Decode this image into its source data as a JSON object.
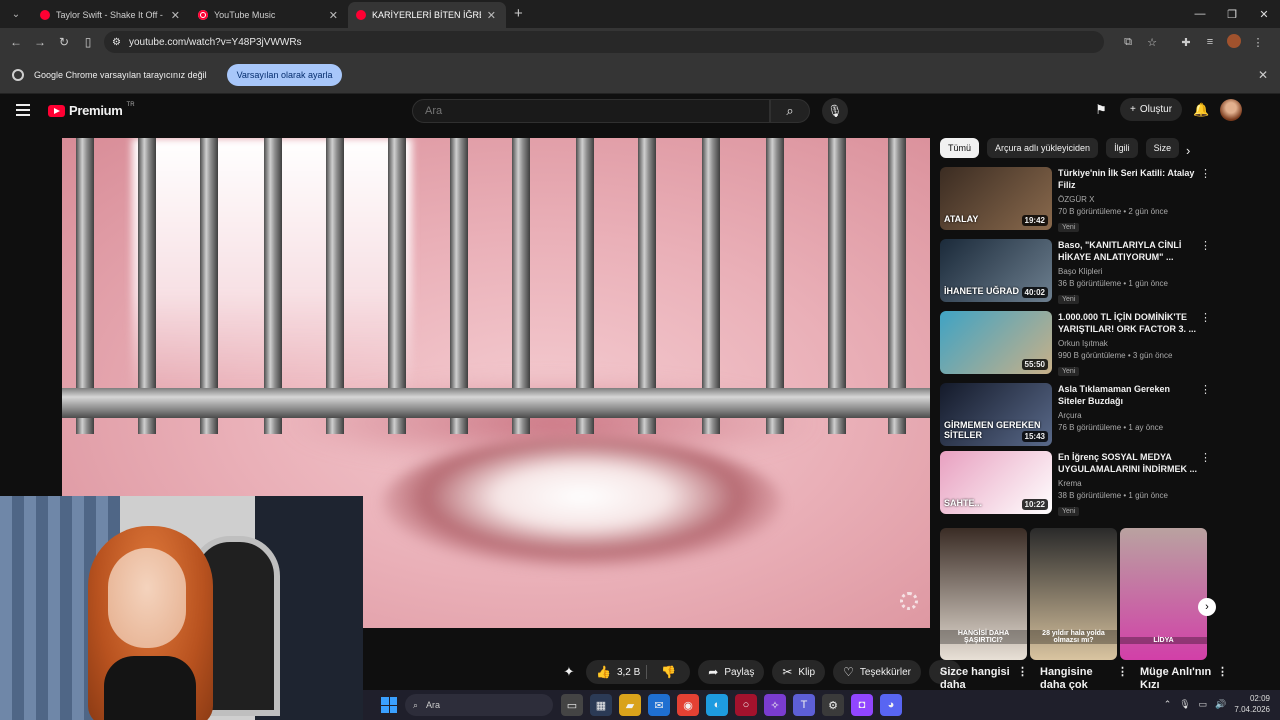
{
  "browser": {
    "tabs": [
      {
        "title": "Taylor Swift - Shake It Off - You",
        "icon": "youtube-icon",
        "active": false
      },
      {
        "title": "YouTube Music",
        "icon": "youtube-music-icon",
        "active": false
      },
      {
        "title": "KARİYERLERİ BİTEN İĞRENÇ YO",
        "icon": "youtube-icon",
        "active": true
      }
    ],
    "url": "youtube.com/watch?v=Y48P3jVWWRs",
    "infobar": {
      "message": "Google Chrome varsayılan tarayıcınız değil",
      "button": "Varsayılan olarak ayarla"
    }
  },
  "youtube": {
    "logo_text": "Premium",
    "logo_tag": "TR",
    "search_placeholder": "Ara",
    "create_label": "Oluştur",
    "actions": {
      "likes": "3,2 B",
      "share": "Paylaş",
      "clip": "Klip",
      "thanks": "Teşekkürler"
    },
    "chips": [
      "Tümü",
      "Arçura adlı yükleyiciden",
      "İlgili",
      "Size"
    ],
    "recommendations": [
      {
        "title": "Türkiye'nin İlk Seri Katili: Atalay Filiz",
        "channel": "ÖZGÜR X",
        "meta": "70 B görüntüleme • 2 gün önce",
        "badge": "Yeni",
        "duration": "19:42",
        "thumb_text": "ATALAY",
        "colors": [
          "#3b2c22",
          "#8a6a4d"
        ]
      },
      {
        "title": "Baso, \"KANITLARIYLA CİNLİ HİKAYE ANLATIYORUM\" ...",
        "channel": "Başo Klipleri",
        "meta": "36 B görüntüleme • 1 gün önce",
        "badge": "Yeni",
        "duration": "40:02",
        "thumb_text": "İHANETE UĞRAD",
        "colors": [
          "#1b2a3a",
          "#6d7f8f"
        ]
      },
      {
        "title": "1.000.000 TL İÇİN DOMİNİK'TE YARIŞTILAR! ORK FACTOR 3. ...",
        "channel": "Orkun Işıtmak",
        "meta": "990 B görüntüleme • 3 gün önce",
        "badge": "Yeni",
        "duration": "55:50",
        "thumb_text": "",
        "colors": [
          "#3fa3c4",
          "#c8b088"
        ]
      },
      {
        "title": "Asla Tıklamaman Gereken Siteler Buzdağı",
        "channel": "Arçura",
        "meta": "76 B görüntüleme • 1 ay önce",
        "badge": "",
        "duration": "15:43",
        "thumb_text": "GİRMEMEN GEREKEN SİTELER",
        "colors": [
          "#141a2a",
          "#5a6a8a"
        ]
      },
      {
        "title": "En İğrenç SOSYAL MEDYA UYGULAMALARINI İNDİRMEK ...",
        "channel": "Krema",
        "meta": "38 B görüntüleme • 1 gün önce",
        "badge": "Yeni",
        "duration": "10:22",
        "thumb_text": "SAHTE...",
        "colors": [
          "#e8a0c0",
          "#ffffff"
        ]
      }
    ],
    "shorts": [
      {
        "label": "HANGİSİ DAHA ŞAŞIRTICI?",
        "colors": [
          "#3a2c25",
          "#e8e0d6"
        ]
      },
      {
        "label": "28 yıldır hala yolda olmazsı mı?",
        "colors": [
          "#2a2a2a",
          "#d9c4a0"
        ]
      },
      {
        "label": "LİDYA",
        "colors": [
          "#b9a2a0",
          "#d23fa8"
        ]
      }
    ],
    "shorts_titles": [
      "Sizce hangisi daha",
      "Hangisine daha çok",
      "Müge Anlı'nın Kızı"
    ]
  },
  "taskbar": {
    "search_placeholder": "Ara",
    "time": "02:09",
    "date": "7.04.2026"
  },
  "colors": {
    "accent_red": "#ff0033",
    "infobar_button": "#a8c7fa"
  }
}
